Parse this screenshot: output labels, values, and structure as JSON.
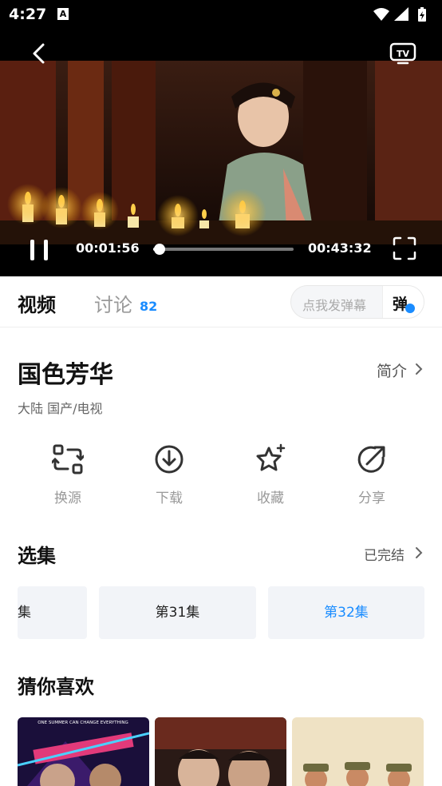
{
  "status_bar": {
    "time": "4:27",
    "notification_icon": "A"
  },
  "player": {
    "current_time": "00:01:56",
    "duration": "00:43:32",
    "progress": 0.044
  },
  "tabs": {
    "video": "视频",
    "discussion": "讨论",
    "discussion_count": "82"
  },
  "danmu": {
    "placeholder": "点我发弹幕",
    "button": "弹"
  },
  "show": {
    "title": "国色芳华",
    "intro_label": "简介",
    "meta": "大陆  国产/电视"
  },
  "actions": [
    {
      "label": "换源",
      "icon": "switch-source-icon"
    },
    {
      "label": "下载",
      "icon": "download-icon"
    },
    {
      "label": "收藏",
      "icon": "favorite-star-icon"
    },
    {
      "label": "分享",
      "icon": "share-icon"
    }
  ],
  "episodes": {
    "title": "选集",
    "status": "已完结",
    "items": [
      "集",
      "第31集",
      "第32集"
    ],
    "active_index": 2
  },
  "recommend": {
    "title": "猜你喜欢",
    "poster_text": "ONE SUMMER CAN CHANGE EVERYTHING"
  },
  "colors": {
    "accent": "#1a8cff",
    "player_bg": "#000000"
  }
}
